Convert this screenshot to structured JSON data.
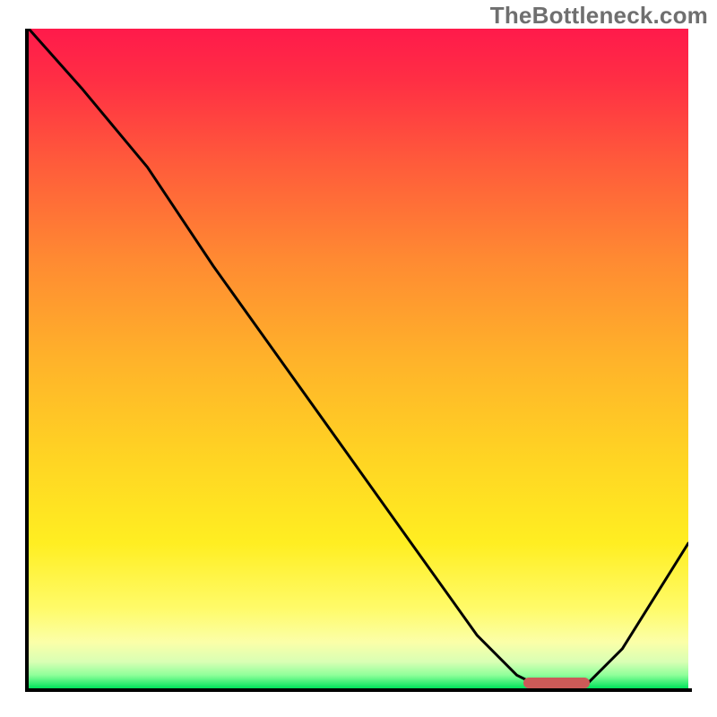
{
  "watermark": "TheBottleneck.com",
  "chart_data": {
    "type": "line",
    "title": "",
    "xlabel": "",
    "ylabel": "",
    "xlim": [
      0,
      100
    ],
    "ylim": [
      0,
      100
    ],
    "grid": false,
    "series": [
      {
        "name": "bottleneck-curve",
        "x": [
          0,
          8,
          18,
          28,
          38,
          48,
          58,
          68,
          74,
          78,
          84,
          90,
          100
        ],
        "y": [
          100,
          91,
          79,
          64,
          50,
          36,
          22,
          8,
          2,
          0,
          0,
          6,
          22
        ]
      }
    ],
    "background_gradient": {
      "top": "#ff1a4b",
      "upper_mid": "#ffb22a",
      "lower_mid": "#ffee22",
      "bottom": "#00e35c"
    },
    "optimal_marker": {
      "x_start": 75,
      "x_end": 85,
      "color": "#cc5a58"
    }
  }
}
